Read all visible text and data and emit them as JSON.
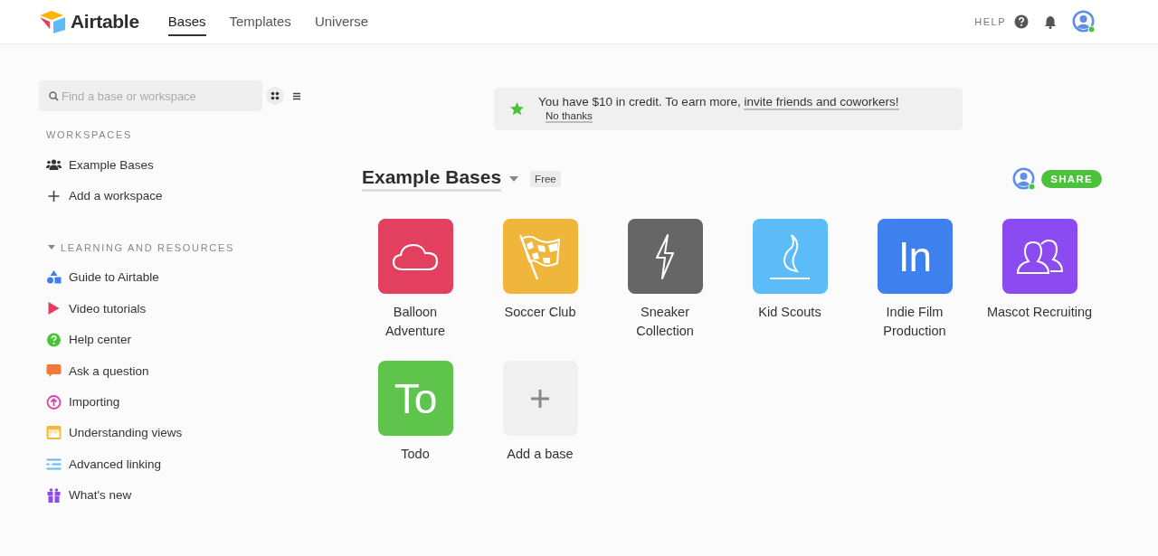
{
  "header": {
    "logo": "Airtable",
    "tabs": [
      {
        "label": "Bases",
        "selected": true
      },
      {
        "label": "Templates",
        "selected": false
      },
      {
        "label": "Universe",
        "selected": false
      }
    ],
    "help": "HELP",
    "avatar_online": true
  },
  "sidebar": {
    "search": {
      "placeholder": "Find a base or workspace"
    },
    "view_buttons": [
      {
        "kind": "grid",
        "selected": true
      },
      {
        "kind": "list",
        "selected": false
      }
    ],
    "workspaces_heading": "WORKSPACES",
    "workspaces": [
      {
        "kind": "workspace",
        "label": "Example Bases"
      },
      {
        "kind": "add",
        "label": "Add a workspace"
      }
    ],
    "resources_heading": "LEARNING AND RESOURCES",
    "resources_expanded": true,
    "resources": [
      {
        "kind": "guide",
        "label": "Guide to Airtable"
      },
      {
        "kind": "video",
        "label": "Video tutorials"
      },
      {
        "kind": "help",
        "label": "Help center"
      },
      {
        "kind": "question",
        "label": "Ask a question"
      },
      {
        "kind": "import",
        "label": "Importing"
      },
      {
        "kind": "views",
        "label": "Understanding views"
      },
      {
        "kind": "linking",
        "label": "Advanced linking"
      },
      {
        "kind": "new",
        "label": "What's new"
      }
    ]
  },
  "banner": {
    "text": "You have $10 in credit. To earn more,",
    "link": "invite friends and coworkers!",
    "dismiss": "No thanks"
  },
  "workspace": {
    "title": "Example Bases",
    "plan": "Free",
    "share": "SHARE",
    "collaborator_online": true,
    "bases": [
      {
        "kind": "cloud",
        "name": "Balloon Adventure",
        "color": "#e33f5f"
      },
      {
        "kind": "flag",
        "name": "Soccer Club",
        "color": "#f0b63c"
      },
      {
        "kind": "bolt",
        "name": "Sneaker Collection",
        "color": "#666666"
      },
      {
        "kind": "flame",
        "name": "Kid Scouts",
        "color": "#5bbcf7"
      },
      {
        "kind": "monogram",
        "monogram": "In",
        "name": "Indie Film Production",
        "color": "#3f80ef"
      },
      {
        "kind": "people",
        "name": "Mascot Recruiting",
        "color": "#8b4bf0"
      },
      {
        "kind": "monogram",
        "monogram": "To",
        "name": "Todo",
        "color": "#5ec44b"
      },
      {
        "kind": "add",
        "name": "Add a base",
        "color": "#f0f0f0"
      }
    ]
  }
}
